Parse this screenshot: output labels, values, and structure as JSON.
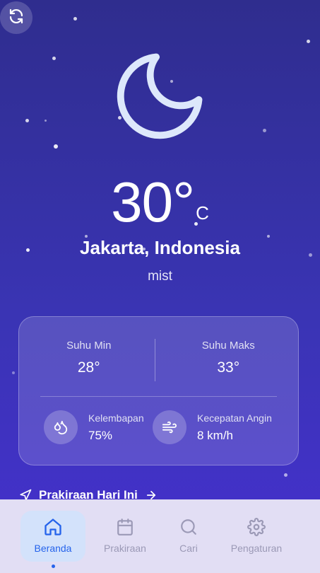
{
  "header": {
    "refresh_icon": "refresh-icon"
  },
  "weather": {
    "icon": "moon-icon",
    "temperature": "30°",
    "unit": "C",
    "location": "Jakarta, Indonesia",
    "condition": "mist"
  },
  "card": {
    "min_label": "Suhu Min",
    "min_value": "28°",
    "max_label": "Suhu Maks",
    "max_value": "33°",
    "humidity_label": "Kelembapan",
    "humidity_value": "75%",
    "wind_label": "Kecepatan Angin",
    "wind_value": "8 km/h"
  },
  "forecast_link": {
    "label": "Prakiraan Hari Ini"
  },
  "nav": {
    "items": [
      {
        "label": "Beranda",
        "icon": "home-icon",
        "active": true
      },
      {
        "label": "Prakiraan",
        "icon": "calendar-icon",
        "active": false
      },
      {
        "label": "Cari",
        "icon": "search-icon",
        "active": false
      },
      {
        "label": "Pengaturan",
        "icon": "gear-icon",
        "active": false
      }
    ]
  },
  "colors": {
    "background_top": "#2f2d8e",
    "background_bottom": "#4530cf",
    "nav_background": "#e2def4",
    "nav_active_bg": "#d3e2fb",
    "accent": "#2563eb"
  }
}
